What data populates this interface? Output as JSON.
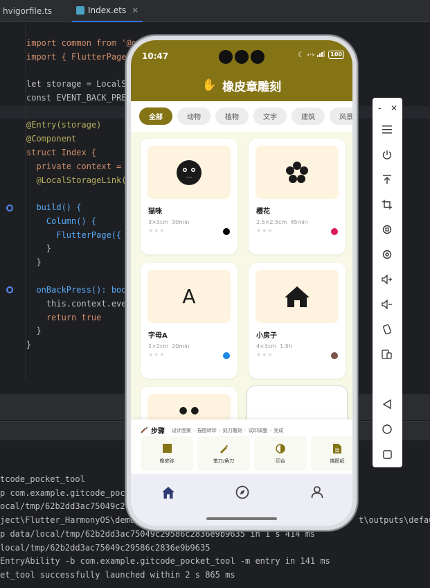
{
  "ide": {
    "tabs": [
      {
        "name": "hvigorfile.ts"
      },
      {
        "name": "Index.ets"
      }
    ],
    "code_lines": [
      "import common from '@o",
      "import { FlutterPage",
      "let storage = LocalS",
      "const EVENT_BACK_PRE",
      "@Entry(storage)",
      "@Component",
      "struct Index {",
      "  private context = ",
      "  @LocalStorageLink('",
      "  build() {",
      "    Column() {",
      "      FlutterPage({",
      "    }",
      "  }",
      "  onBackPress(): boo",
      "    this.context.eve",
      "    return true",
      "  }",
      "}"
    ],
    "console_lines": [
      "tcode_pocket_tool",
      "p com.example.gitcode_pock",
      "ocal/tmp/62b2dd3ac75049c29",
      "ject\\Flutter_HarmonyOS\\demo",
      "p data/local/tmp/62b2dd3ac75049c29586c2836e9b9635 in 1 s 414 ms",
      "local/tmp/62b2dd3ac75049c29586c2836e9b9635",
      "EntryAbility -b com.example.gitcode_pocket_tool -m entry in 141 ms",
      "et_tool successfully launched within 2 s 865 ms"
    ],
    "console_fragment": "t\\outputs\\defaul"
  },
  "phone": {
    "status": {
      "time": "10:47",
      "battery": "100"
    },
    "app_title": "橡皮章雕刻",
    "title_icon": "✋",
    "filters": [
      {
        "label": "全部",
        "selected": true
      },
      {
        "label": "动物",
        "selected": false
      },
      {
        "label": "植物",
        "selected": false
      },
      {
        "label": "文字",
        "selected": false
      },
      {
        "label": "建筑",
        "selected": false
      },
      {
        "label": "风景",
        "selected": false
      }
    ],
    "cards": [
      {
        "title": "猫咪",
        "size": "3×3cm",
        "time": "30min",
        "stars": "★★★",
        "color": "#000000",
        "icon": "cat-face-icon"
      },
      {
        "title": "樱花",
        "size": "2.5×2.5cm",
        "time": "45min",
        "stars": "★★★",
        "color": "#d81b60",
        "icon": "flower-icon"
      },
      {
        "title": "字母A",
        "size": "2×2cm",
        "time": "20min",
        "stars": "★★★",
        "color": "#1e88e5",
        "icon": "letter-a-icon",
        "glyph": "A"
      },
      {
        "title": "小房子",
        "size": "4×3cm",
        "time": "1.5h",
        "stars": "★★★",
        "color": "#795548",
        "icon": "house-icon"
      }
    ],
    "steps": {
      "title": "步骤",
      "items": [
        "设计图案",
        "描图转印",
        "刻刀雕刻",
        "试印调整",
        "完成"
      ]
    },
    "tools": [
      {
        "label": "橡皮砖",
        "icon": "eraser-block-icon"
      },
      {
        "label": "笔刀/角刀",
        "icon": "pen-knife-icon"
      },
      {
        "label": "印台",
        "icon": "ink-pad-icon"
      },
      {
        "label": "描图纸",
        "icon": "tracing-paper-icon"
      }
    ],
    "nav": [
      "home-icon",
      "compass-icon",
      "person-icon"
    ]
  },
  "emulator_toolbar": {
    "minimize": "-",
    "close": "✕",
    "buttons": [
      "menu-icon",
      "power-icon",
      "pin-top-icon",
      "crop-icon",
      "rotate-icon",
      "at-icon",
      "volume-up-icon",
      "volume-down-icon",
      "device-rotate-icon",
      "multi-device-icon",
      "back-icon",
      "home-circle-icon",
      "recent-square-icon"
    ]
  },
  "colors": {
    "brand": "#857416",
    "card_image_bg": "#fdf3df",
    "grid_bg": "#f8f8e6"
  }
}
